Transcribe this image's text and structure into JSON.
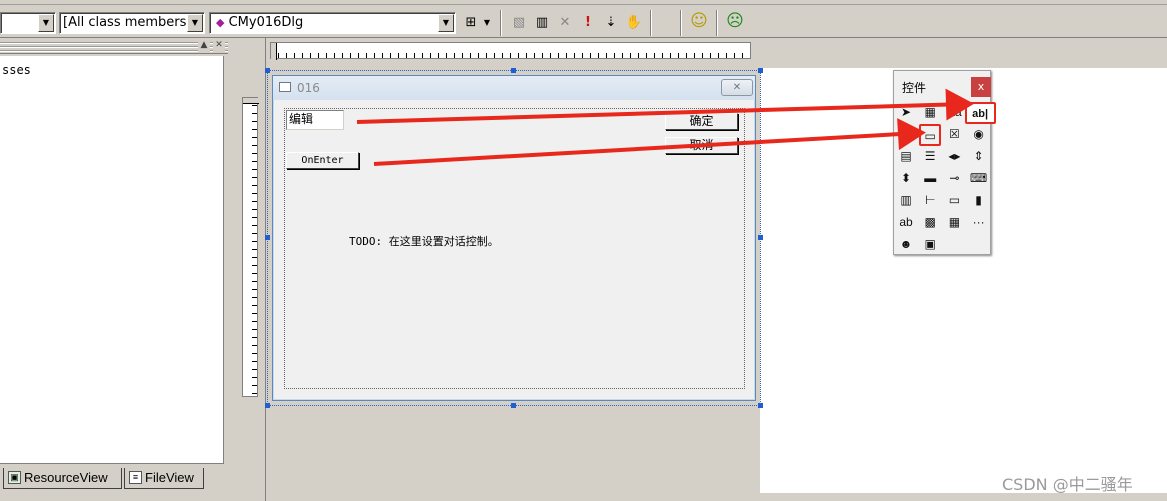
{
  "toolbar": {
    "combo_class_members": "[All class members]",
    "combo_class_name": "CMy016Dlg"
  },
  "workspace": {
    "tree_text": "sses",
    "tabs": [
      {
        "label": "ResourceView"
      },
      {
        "label": "FileView"
      }
    ]
  },
  "dialog": {
    "title": "016",
    "edit_text": "编辑",
    "ok_label": "确定",
    "cancel_label": "取消",
    "onenter_label": "OnEnter",
    "todo_text": "TODO: 在这里设置对话控制。"
  },
  "palette": {
    "title": "控件",
    "close": "x",
    "cells": [
      {
        "name": "pointer-icon",
        "glyph": "➤"
      },
      {
        "name": "picture-icon",
        "glyph": "▦"
      },
      {
        "name": "static-text-icon",
        "glyph": "Aa"
      },
      {
        "name": "edit-box-icon",
        "glyph": "ab|"
      },
      {
        "name": "group-box-icon",
        "glyph": "⌐"
      },
      {
        "name": "button-icon",
        "glyph": "▭"
      },
      {
        "name": "check-box-icon",
        "glyph": "☒"
      },
      {
        "name": "radio-button-icon",
        "glyph": "◉"
      },
      {
        "name": "combo-box-icon",
        "glyph": "▤"
      },
      {
        "name": "list-box-icon",
        "glyph": "☰"
      },
      {
        "name": "h-scrollbar-icon",
        "glyph": "◂▸"
      },
      {
        "name": "v-scrollbar-icon",
        "glyph": "⇕"
      },
      {
        "name": "spin-icon",
        "glyph": "⬍"
      },
      {
        "name": "progress-icon",
        "glyph": "▬"
      },
      {
        "name": "slider-icon",
        "glyph": "⊸"
      },
      {
        "name": "hotkey-icon",
        "glyph": "⌨"
      },
      {
        "name": "list-control-icon",
        "glyph": "▥"
      },
      {
        "name": "tree-control-icon",
        "glyph": "⊢"
      },
      {
        "name": "tab-control-icon",
        "glyph": "▭"
      },
      {
        "name": "animate-icon",
        "glyph": "▮"
      },
      {
        "name": "rich-edit-icon",
        "glyph": "ab"
      },
      {
        "name": "date-time-icon",
        "glyph": "▩"
      },
      {
        "name": "month-calendar-icon",
        "glyph": "▦"
      },
      {
        "name": "ip-address-icon",
        "glyph": "···"
      },
      {
        "name": "custom-control-icon",
        "glyph": "☻"
      },
      {
        "name": "extended-combo-icon",
        "glyph": "▣"
      }
    ]
  },
  "watermark": "CSDN @中二骚年",
  "colors": {
    "chrome": "#d4d0c8",
    "highlight_red": "#e8281c",
    "selection_blue": "#1f5fd0"
  }
}
